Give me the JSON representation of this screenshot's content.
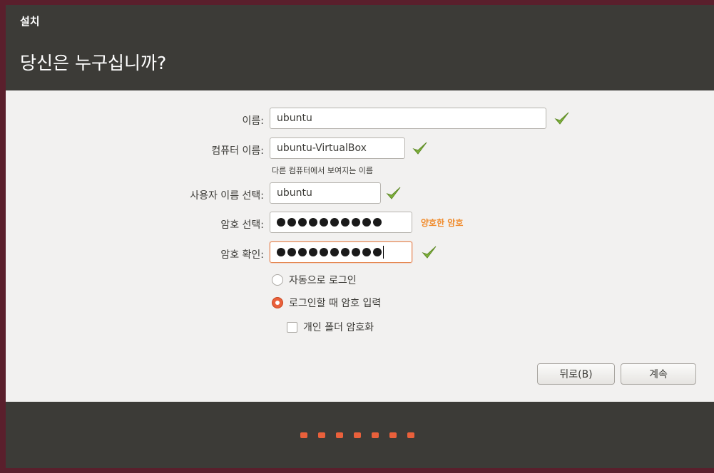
{
  "window": {
    "title": "설치",
    "heading": "당신은 누구십니까?"
  },
  "form": {
    "name_label": "이름:",
    "name_value": "ubuntu",
    "computer_label": "컴퓨터 이름:",
    "computer_value": "ubuntu-VirtualBox",
    "computer_hint": "다른 컴퓨터에서 보여지는 이름",
    "username_label": "사용자 이름 선택:",
    "username_value": "ubuntu",
    "password_label": "암호 선택:",
    "password_strength": "양호한 암호",
    "confirm_label": "암호 확인:",
    "password_mask_count": 10
  },
  "options": {
    "auto_login": "자동으로 로그인",
    "require_password": "로그인할 때 암호 입력",
    "encrypt_home": "개인 폴더 암호화",
    "selected": "require_password",
    "encrypt_checked": false
  },
  "buttons": {
    "back": "뒤로(B)",
    "continue": "계속"
  },
  "progress": {
    "total_steps": 7
  },
  "colors": {
    "accent": "#e9603b",
    "check": "#7fb13b",
    "strength": "#f08a2a",
    "bar": "#3c3b37"
  },
  "icons": {
    "valid": "check-icon"
  }
}
